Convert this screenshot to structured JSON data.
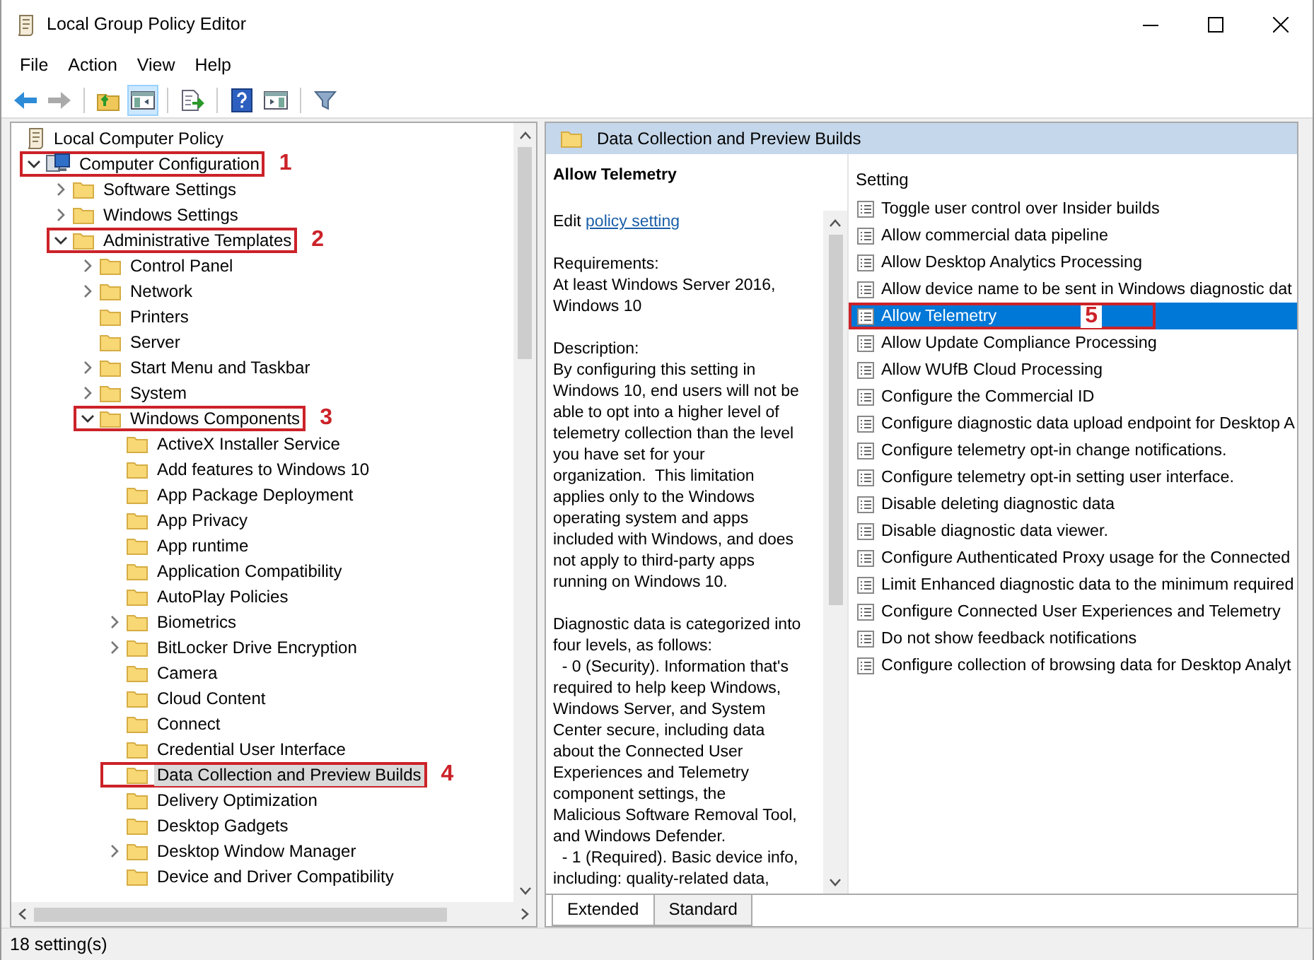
{
  "window": {
    "title": "Local Group Policy Editor"
  },
  "menu": [
    "File",
    "Action",
    "View",
    "Help"
  ],
  "toolbar": [
    {
      "kind": "back",
      "pressed": false,
      "disabled": false
    },
    {
      "kind": "forward",
      "pressed": false,
      "disabled": true
    },
    {
      "kind": "up",
      "pressed": false,
      "disabled": false
    },
    {
      "kind": "tree",
      "pressed": true,
      "disabled": false
    },
    {
      "kind": "export",
      "pressed": false,
      "disabled": false
    },
    {
      "kind": "help",
      "pressed": false,
      "disabled": false
    },
    {
      "kind": "pane",
      "pressed": false,
      "disabled": false
    },
    {
      "kind": "filter",
      "pressed": false,
      "disabled": false
    }
  ],
  "tree": [
    {
      "label": "Local Computer Policy",
      "kind": "root",
      "selected": false,
      "children": [
        {
          "label": "Computer Configuration",
          "kind": "computer",
          "expanded": true,
          "selected": false,
          "callout": "1",
          "children": [
            {
              "label": "Software Settings",
              "kind": "folder",
              "expanded": false,
              "selected": false
            },
            {
              "label": "Windows Settings",
              "kind": "folder",
              "expanded": false,
              "selected": false
            },
            {
              "label": "Administrative Templates",
              "kind": "folder",
              "expanded": true,
              "selected": false,
              "callout": "2",
              "children": [
                {
                  "label": "Control Panel",
                  "kind": "folder",
                  "expanded": false,
                  "selected": false
                },
                {
                  "label": "Network",
                  "kind": "folder",
                  "expanded": false,
                  "selected": false
                },
                {
                  "label": "Printers",
                  "kind": "folder",
                  "selected": false
                },
                {
                  "label": "Server",
                  "kind": "folder",
                  "selected": false
                },
                {
                  "label": "Start Menu and Taskbar",
                  "kind": "folder",
                  "expanded": false,
                  "selected": false
                },
                {
                  "label": "System",
                  "kind": "folder",
                  "expanded": false,
                  "selected": false
                },
                {
                  "label": "Windows Components",
                  "kind": "folder",
                  "expanded": true,
                  "selected": false,
                  "callout": "3",
                  "children": [
                    {
                      "label": "ActiveX Installer Service",
                      "kind": "folder",
                      "selected": false
                    },
                    {
                      "label": "Add features to Windows 10",
                      "kind": "folder",
                      "selected": false
                    },
                    {
                      "label": "App Package Deployment",
                      "kind": "folder",
                      "selected": false
                    },
                    {
                      "label": "App Privacy",
                      "kind": "folder",
                      "selected": false
                    },
                    {
                      "label": "App runtime",
                      "kind": "folder",
                      "selected": false
                    },
                    {
                      "label": "Application Compatibility",
                      "kind": "folder",
                      "selected": false
                    },
                    {
                      "label": "AutoPlay Policies",
                      "kind": "folder",
                      "selected": false
                    },
                    {
                      "label": "Biometrics",
                      "kind": "folder",
                      "expanded": false,
                      "selected": false
                    },
                    {
                      "label": "BitLocker Drive Encryption",
                      "kind": "folder",
                      "expanded": false,
                      "selected": false
                    },
                    {
                      "label": "Camera",
                      "kind": "folder",
                      "selected": false
                    },
                    {
                      "label": "Cloud Content",
                      "kind": "folder",
                      "selected": false
                    },
                    {
                      "label": "Connect",
                      "kind": "folder",
                      "selected": false
                    },
                    {
                      "label": "Credential User Interface",
                      "kind": "folder",
                      "selected": false
                    },
                    {
                      "label": "Data Collection and Preview Builds",
                      "kind": "folder",
                      "selected": true,
                      "callout": "4"
                    },
                    {
                      "label": "Delivery Optimization",
                      "kind": "folder",
                      "selected": false
                    },
                    {
                      "label": "Desktop Gadgets",
                      "kind": "folder",
                      "selected": false
                    },
                    {
                      "label": "Desktop Window Manager",
                      "kind": "folder",
                      "expanded": false,
                      "selected": false
                    },
                    {
                      "label": "Device and Driver Compatibility",
                      "kind": "folder",
                      "selected": false
                    }
                  ]
                }
              ]
            }
          ]
        }
      ]
    }
  ],
  "details": {
    "header": "Data Collection and Preview Builds",
    "title": "Allow Telemetry",
    "edit_prefix": "Edit",
    "edit_link": "policy setting",
    "paragraphs": [
      [
        "Requirements:",
        "At least Windows Server 2016,",
        "Windows 10"
      ],
      [
        "Description:",
        "By configuring this setting in",
        "Windows 10, end users will not be",
        "able to opt into a higher level of",
        "telemetry collection than the level",
        "you have set for your",
        "organization.  This limitation",
        "applies only to the Windows",
        "operating system and apps",
        "included with Windows, and does",
        "not apply to third-party apps",
        "running on Windows 10."
      ],
      [
        "Diagnostic data is categorized into",
        "four levels, as follows:",
        "  - 0 (Security). Information that's",
        "required to help keep Windows,",
        "Windows Server, and System",
        "Center secure, including data",
        "about the Connected User",
        "Experiences and Telemetry",
        "component settings, the",
        "Malicious Software Removal Tool,",
        "and Windows Defender.",
        "  - 1 (Required). Basic device info,",
        "including: quality-related data,"
      ]
    ],
    "column": "Setting",
    "settings": [
      {
        "label": "Toggle user control over Insider builds",
        "selected": false
      },
      {
        "label": "Allow commercial data pipeline",
        "selected": false
      },
      {
        "label": "Allow Desktop Analytics Processing",
        "selected": false
      },
      {
        "label": "Allow device name to be sent in Windows diagnostic dat",
        "selected": false
      },
      {
        "label": "Allow Telemetry",
        "selected": true,
        "callout": "5"
      },
      {
        "label": "Allow Update Compliance Processing",
        "selected": false
      },
      {
        "label": "Allow WUfB Cloud Processing",
        "selected": false
      },
      {
        "label": "Configure the Commercial ID",
        "selected": false
      },
      {
        "label": "Configure diagnostic data upload endpoint for Desktop A",
        "selected": false
      },
      {
        "label": "Configure telemetry opt-in change notifications.",
        "selected": false
      },
      {
        "label": "Configure telemetry opt-in setting user interface.",
        "selected": false
      },
      {
        "label": "Disable deleting diagnostic data",
        "selected": false
      },
      {
        "label": "Disable diagnostic data viewer.",
        "selected": false
      },
      {
        "label": "Configure Authenticated Proxy usage for the Connected",
        "selected": false
      },
      {
        "label": "Limit Enhanced diagnostic data to the minimum required",
        "selected": false
      },
      {
        "label": "Configure Connected User Experiences and Telemetry",
        "selected": false
      },
      {
        "label": "Do not show feedback notifications",
        "selected": false
      },
      {
        "label": "Configure collection of browsing data for Desktop Analyt",
        "selected": false
      }
    ],
    "tabs": [
      {
        "label": "Extended",
        "selected": true
      },
      {
        "label": "Standard",
        "selected": false
      }
    ]
  },
  "status_bar": "18 setting(s)"
}
